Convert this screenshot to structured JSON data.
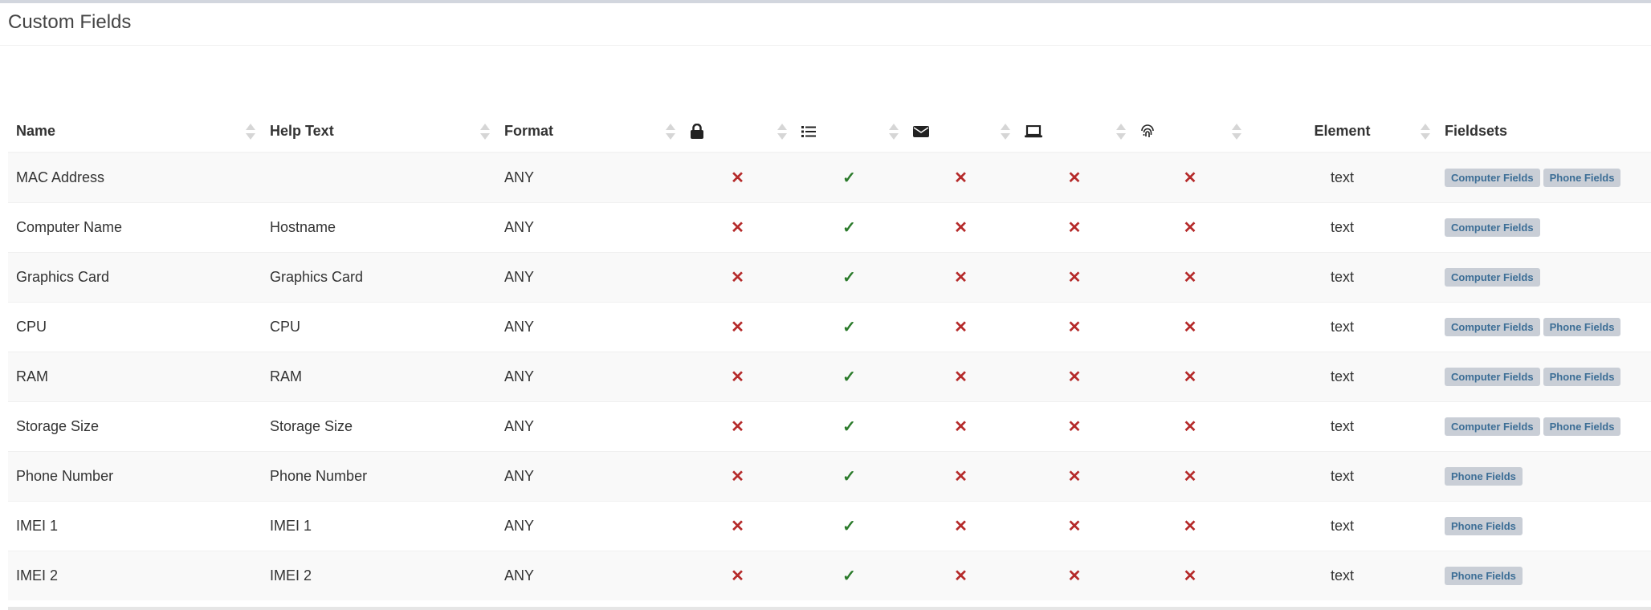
{
  "page": {
    "title": "Custom Fields"
  },
  "table": {
    "headers": {
      "name": "Name",
      "help_text": "Help Text",
      "format": "Format",
      "element": "Element",
      "fieldsets": "Fieldsets"
    },
    "icon_columns": [
      "lock-icon",
      "list-icon",
      "envelope-icon",
      "laptop-icon",
      "fingerprint-icon"
    ],
    "rows": [
      {
        "name": "MAC Address",
        "help_text": "",
        "format": "ANY",
        "flags": [
          "x",
          "check",
          "x",
          "x",
          "x"
        ],
        "element": "text",
        "fieldsets": [
          "Computer Fields",
          "Phone Fields"
        ]
      },
      {
        "name": "Computer Name",
        "help_text": "Hostname",
        "format": "ANY",
        "flags": [
          "x",
          "check",
          "x",
          "x",
          "x"
        ],
        "element": "text",
        "fieldsets": [
          "Computer Fields"
        ]
      },
      {
        "name": "Graphics Card",
        "help_text": "Graphics Card",
        "format": "ANY",
        "flags": [
          "x",
          "check",
          "x",
          "x",
          "x"
        ],
        "element": "text",
        "fieldsets": [
          "Computer Fields"
        ]
      },
      {
        "name": "CPU",
        "help_text": "CPU",
        "format": "ANY",
        "flags": [
          "x",
          "check",
          "x",
          "x",
          "x"
        ],
        "element": "text",
        "fieldsets": [
          "Computer Fields",
          "Phone Fields"
        ]
      },
      {
        "name": "RAM",
        "help_text": "RAM",
        "format": "ANY",
        "flags": [
          "x",
          "check",
          "x",
          "x",
          "x"
        ],
        "element": "text",
        "fieldsets": [
          "Computer Fields",
          "Phone Fields"
        ]
      },
      {
        "name": "Storage Size",
        "help_text": "Storage Size",
        "format": "ANY",
        "flags": [
          "x",
          "check",
          "x",
          "x",
          "x"
        ],
        "element": "text",
        "fieldsets": [
          "Computer Fields",
          "Phone Fields"
        ]
      },
      {
        "name": "Phone Number",
        "help_text": "Phone Number",
        "format": "ANY",
        "flags": [
          "x",
          "check",
          "x",
          "x",
          "x"
        ],
        "element": "text",
        "fieldsets": [
          "Phone Fields"
        ]
      },
      {
        "name": "IMEI 1",
        "help_text": "IMEI 1",
        "format": "ANY",
        "flags": [
          "x",
          "check",
          "x",
          "x",
          "x"
        ],
        "element": "text",
        "fieldsets": [
          "Phone Fields"
        ]
      },
      {
        "name": "IMEI 2",
        "help_text": "IMEI 2",
        "format": "ANY",
        "flags": [
          "x",
          "check",
          "x",
          "x",
          "x"
        ],
        "element": "text",
        "fieldsets": [
          "Phone Fields"
        ]
      }
    ],
    "marks": {
      "x": "✕",
      "check": "✓"
    },
    "colors": {
      "x": "#b52a2a",
      "check": "#2a7a2a",
      "badge_bg": "#c9ced6",
      "badge_text": "#3c6e96"
    }
  }
}
